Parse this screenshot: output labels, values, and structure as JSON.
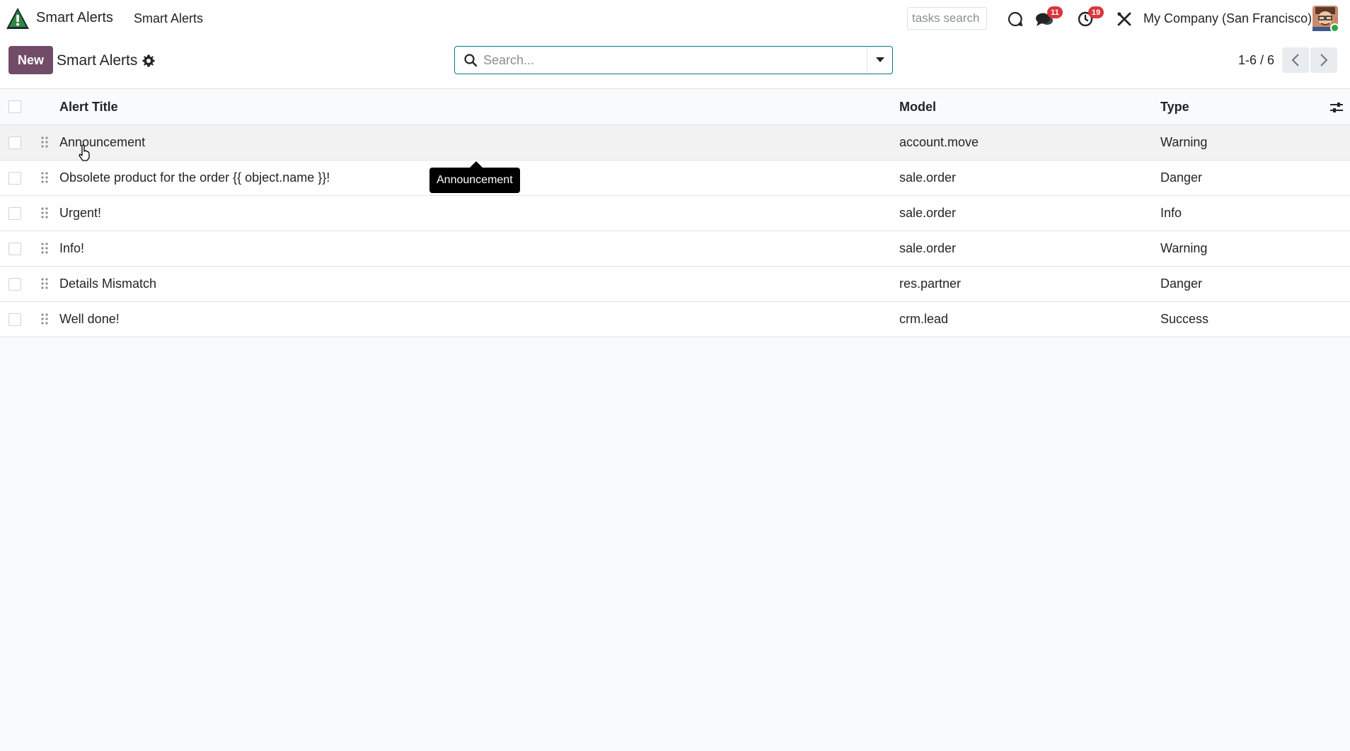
{
  "navbar": {
    "app_name": "Smart Alerts",
    "menu_item": "Smart Alerts",
    "tasks_search_placeholder": "tasks search",
    "chat_badge": "11",
    "activity_badge": "19",
    "company": "My Company (San Francisco)"
  },
  "control_panel": {
    "new_label": "New",
    "title": "Smart Alerts",
    "search_placeholder": "Search...",
    "pager_value": "1-6 / 6"
  },
  "table": {
    "columns": [
      "Alert Title",
      "Model",
      "Type"
    ],
    "rows": [
      {
        "title": "Announcement",
        "model": "account.move",
        "type": "Warning"
      },
      {
        "title": "Obsolete product for the order {{ object.name }}!",
        "model": "sale.order",
        "type": "Danger"
      },
      {
        "title": "Urgent!",
        "model": "sale.order",
        "type": "Info"
      },
      {
        "title": "Info!",
        "model": "sale.order",
        "type": "Warning"
      },
      {
        "title": "Details Mismatch",
        "model": "res.partner",
        "type": "Danger"
      },
      {
        "title": "Well done!",
        "model": "crm.lead",
        "type": "Success"
      }
    ]
  },
  "tooltip": "Announcement",
  "colors": {
    "brand": "#714b67",
    "search_border": "#017e84",
    "badge": "#d9363e"
  }
}
